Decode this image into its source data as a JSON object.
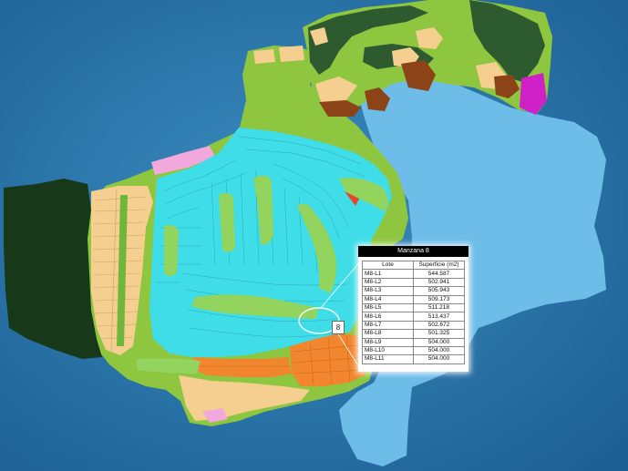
{
  "map": {
    "colors": {
      "ocean": "#2673a4",
      "lagoon": "#6dbde8",
      "mainland": "#8ec63f",
      "forest": "#17391a",
      "dark_green": "#2e5a2f",
      "lots_cyan": "#3fdde8",
      "lots_beige": "#f5cf8f",
      "lots_orange": "#f1862e",
      "brown": "#8b4317",
      "magenta": "#d020c8",
      "pink": "#f2a8dd",
      "fairway": "#92d45e"
    },
    "highlighted_block_number": "8"
  },
  "info": {
    "title": "Manzana 8",
    "columns": [
      "Lote",
      "Superficie (m2)"
    ],
    "rows": [
      {
        "lot": "M8-L1",
        "area": "544.587"
      },
      {
        "lot": "M8-L2",
        "area": "502.941"
      },
      {
        "lot": "M8-L3",
        "area": "505.943"
      },
      {
        "lot": "M8-L4",
        "area": "509.173"
      },
      {
        "lot": "M8-L5",
        "area": "511.218"
      },
      {
        "lot": "M8-L6",
        "area": "513.437"
      },
      {
        "lot": "M8-L7",
        "area": "502.672"
      },
      {
        "lot": "M8-L8",
        "area": "501.325"
      },
      {
        "lot": "M8-L9",
        "area": "504.000"
      },
      {
        "lot": "M8-L10",
        "area": "504.000"
      },
      {
        "lot": "M8-L11",
        "area": "504.000"
      }
    ]
  }
}
